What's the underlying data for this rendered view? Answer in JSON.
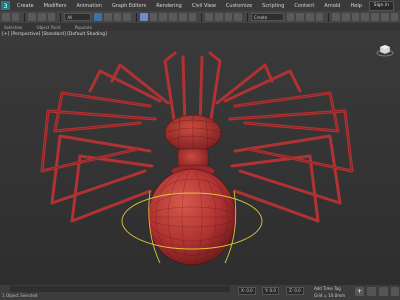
{
  "menubar": {
    "items": [
      "Create",
      "Modifiers",
      "Animation",
      "Graph Editors",
      "Rendering",
      "Civil View",
      "Customize",
      "Scripting",
      "Content",
      "Arnold",
      "Help"
    ],
    "signin": "Sign in"
  },
  "toolbar": {
    "selection_filter": "All",
    "named_selection": "Create Selection Set"
  },
  "ribbon": {
    "items": [
      "Selection",
      "Object Paint",
      "Populate"
    ]
  },
  "viewport": {
    "label": "[+] [Perspective] [Standard] [Default Shading]"
  },
  "statusbar": {
    "left_text": "1 Object Selected",
    "x_value": "X: 0.0",
    "y_value": "Y: 0.0",
    "z_value": "Z: 0.0",
    "grid_value": "Grid = 10.0mm",
    "add_time_tag": "Add Time Tag"
  },
  "colors": {
    "model": "#b03232",
    "model_dark": "#7a1f1f",
    "selection": "#e0c23a"
  }
}
